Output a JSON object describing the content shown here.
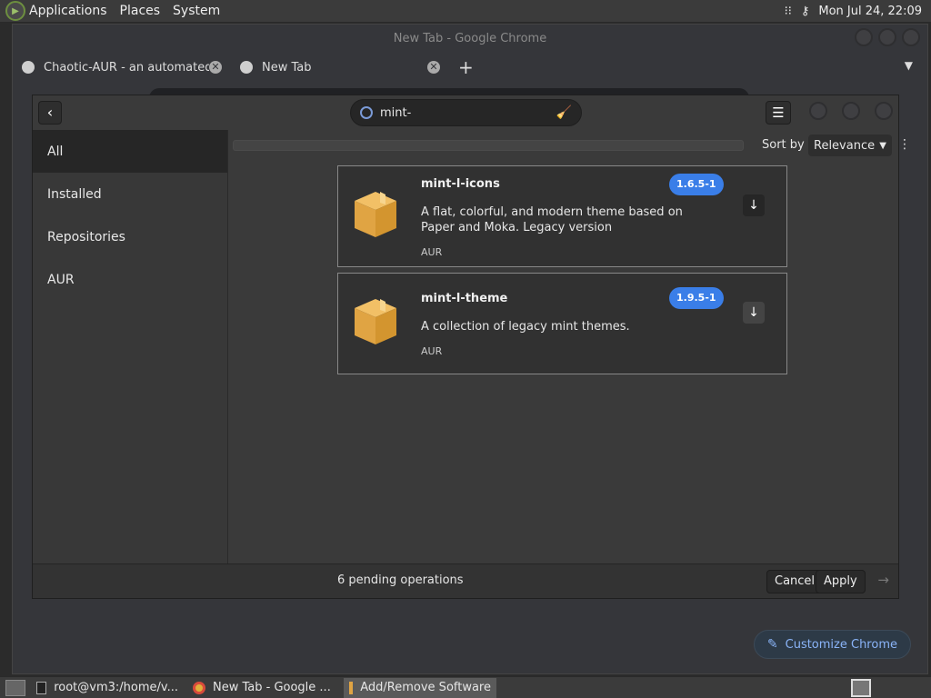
{
  "top_panel": {
    "menus": [
      "Applications",
      "Places",
      "System"
    ],
    "datetime": "Mon Jul 24, 22:09"
  },
  "chrome": {
    "title": "New Tab - Google Chrome",
    "tabs": [
      {
        "label": "Chaotic-AUR - an automated",
        "active": false
      },
      {
        "label": "New Tab",
        "active": true
      }
    ],
    "new_tab_symbol": "+",
    "customize_label": "Customize Chrome"
  },
  "pamac": {
    "search_value": "mint-",
    "sidebar": [
      "All",
      "Installed",
      "Repositories",
      "AUR"
    ],
    "sort_label": "Sort by",
    "sort_value": "Relevance",
    "packages": [
      {
        "name": "mint-l-icons",
        "version": "1.6.5-1",
        "description": "A flat, colorful, and modern theme based on Paper and Moka. Legacy version",
        "repo": "AUR",
        "action": "↓"
      },
      {
        "name": "mint-l-theme",
        "version": "1.9.5-1",
        "description": "A collection of legacy mint themes.",
        "repo": "AUR",
        "action": "↓"
      }
    ],
    "pending": "6 pending operations",
    "cancel_label": "Cancel",
    "apply_label": "Apply"
  },
  "taskbar": {
    "items": [
      {
        "label": "root@vm3:/home/v...",
        "icon": "terminal-icon"
      },
      {
        "label": "New Tab - Google ...",
        "icon": "chrome-icon"
      },
      {
        "label": "Add/Remove Software",
        "icon": "package-icon"
      }
    ]
  }
}
